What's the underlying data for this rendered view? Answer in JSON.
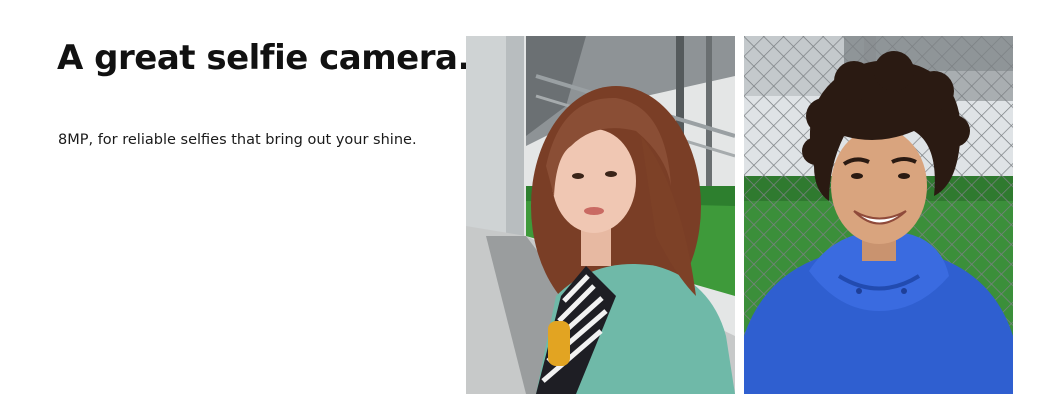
{
  "section": {
    "heading": "A great selfie camera.",
    "description": "8MP, for reliable selfies that bring out your shine."
  },
  "photos": [
    {
      "subject": "woman-selfie",
      "accent_colors": [
        "#6fb9a8",
        "#8a4e35",
        "#2f8f3a"
      ]
    },
    {
      "subject": "man-selfie",
      "accent_colors": [
        "#2f5fd0",
        "#2a1a12",
        "#3b8f3a"
      ]
    }
  ]
}
